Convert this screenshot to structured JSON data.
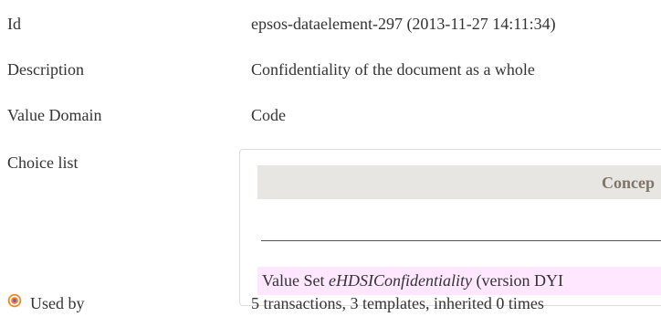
{
  "fields": {
    "id_label": "Id",
    "id_value": "epsos-dataelement-297 (2013-11-27 14:11:34)",
    "description_label": "Description",
    "description_value": "Confidentiality of the document as a whole",
    "value_domain_label": "Value Domain",
    "value_domain_value": "Code",
    "choice_list_label": "Choice list",
    "used_by_label": "Used by",
    "used_by_value": "5 transactions, 3 templates, inherited 0 times"
  },
  "choice_list": {
    "header": "Concep",
    "value_set_prefix": "Value Set ",
    "value_set_name": "eHDSIConfidentiality",
    "value_set_suffix": " (version DYI"
  },
  "icons": {
    "used_by": "target-icon"
  },
  "colors": {
    "header_bg": "#e8e6e2",
    "header_text": "#7f7568",
    "value_set_bg": "#ffe8ff",
    "icon_ring": "#f28c28",
    "icon_center": "#8a5cc2"
  }
}
